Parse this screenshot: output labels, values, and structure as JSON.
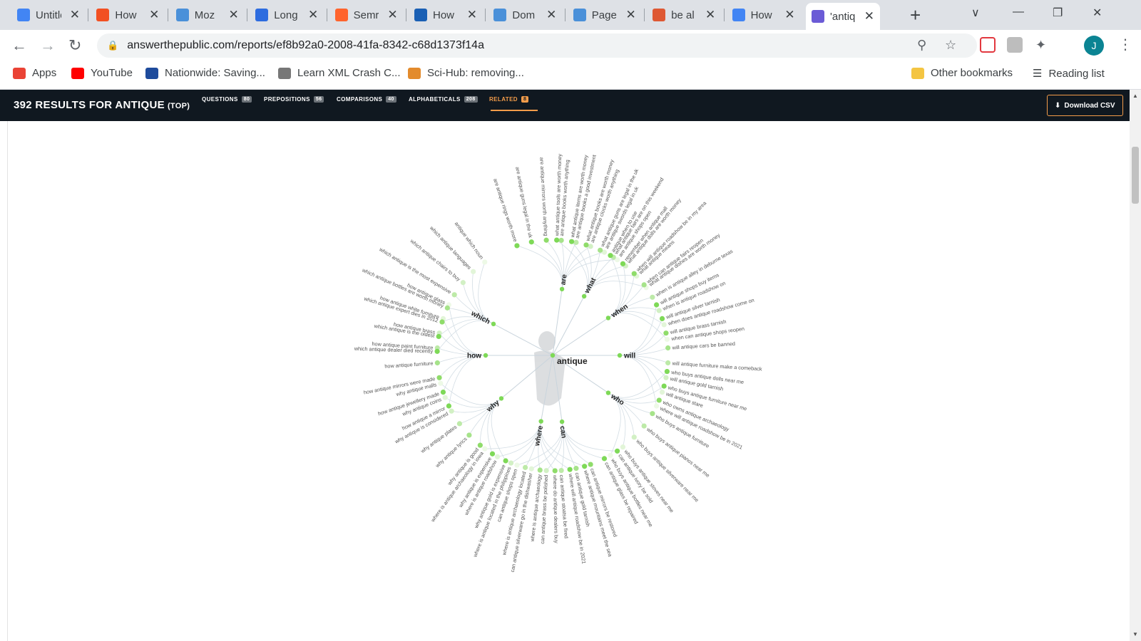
{
  "browser": {
    "tabs": [
      {
        "title": "Untitled",
        "icon": "google-docs-icon",
        "color": "#4285f4"
      },
      {
        "title": "How",
        "icon": "microsoft-icon",
        "color": "#f25022"
      },
      {
        "title": "Moz",
        "icon": "moz-icon",
        "color": "#4a90d9"
      },
      {
        "title": "Long",
        "icon": "longtail-icon",
        "color": "#2d6cdf"
      },
      {
        "title": "Semrush",
        "icon": "semrush-icon",
        "color": "#ff642d"
      },
      {
        "title": "How",
        "icon": "hubpages-icon",
        "color": "#1a5fb4"
      },
      {
        "title": "Dom",
        "icon": "moz-icon",
        "color": "#4a90d9"
      },
      {
        "title": "Page",
        "icon": "moz-icon",
        "color": "#4a90d9"
      },
      {
        "title": "be al",
        "icon": "duckduckgo-icon",
        "color": "#de5833"
      },
      {
        "title": "How",
        "icon": "google-docs-icon",
        "color": "#4285f4"
      },
      {
        "title": "'antique",
        "icon": "answerthepublic-icon",
        "color": "#6b5bd6"
      }
    ],
    "url": "answerthepublic.com/reports/ef8b92a0-2008-41fa-8342-c68d1373f14a",
    "profile_initial": "J",
    "bookmarks": [
      {
        "label": "Apps",
        "icon": "apps-grid-icon",
        "color": "#ea4335"
      },
      {
        "label": "YouTube",
        "icon": "youtube-icon",
        "color": "#ff0000"
      },
      {
        "label": "Nationwide: Saving...",
        "icon": "nationwide-icon",
        "color": "#1e4b9c"
      },
      {
        "label": "Learn XML Crash C...",
        "icon": "xml-icon",
        "color": "#777777"
      },
      {
        "label": "Sci-Hub: removing...",
        "icon": "scihub-icon",
        "color": "#e38b2c"
      }
    ],
    "other_bookmarks": "Other bookmarks",
    "reading_list": "Reading list"
  },
  "site": {
    "results_title": "392 RESULTS FOR ANTIQUE",
    "results_sub": "(TOP)",
    "tabs": [
      {
        "label": "QUESTIONS",
        "count": "80"
      },
      {
        "label": "PREPOSITIONS",
        "count": "56"
      },
      {
        "label": "COMPARISONS",
        "count": "40"
      },
      {
        "label": "ALPHABETICALS",
        "count": "208"
      },
      {
        "label": "RELATED",
        "count": "8"
      }
    ],
    "download_label": "Download CSV",
    "accent": "#f39c4a"
  },
  "wheel": {
    "center_label": "antique",
    "branches": [
      {
        "label": "are",
        "leaves": [
          "are antique rings worth more",
          "are antique guns legal in the uk",
          "are antique mirrors worth anything",
          "are antique books worth anything",
          "are antique books a good investment",
          "are antique clocks worth anything",
          "are antique swords legal in uk",
          "are antique shops open"
        ]
      },
      {
        "label": "what",
        "leaves": [
          "what antique tools are worth money",
          "what antique items are worth money",
          "what antique books are worth money",
          "what antique guns are legal in the uk",
          "what antique fairs are on this weekend",
          "what antique dolls are worth money",
          "what antique means",
          "what antique dishes are worth money"
        ]
      },
      {
        "label": "when",
        "leaves": [
          "antique when to use",
          "remember when antique mall",
          "when will antique roadshow be in my area",
          "when can antique fairs reopen",
          "when is antique alley in deburne texas",
          "when is antique roadshow on",
          "when does antique roadshow come on",
          "when can antique shops reopen"
        ]
      },
      {
        "label": "will",
        "leaves": [
          "will antique shops buy items",
          "will antique silver tarnish",
          "will antique brass tarnish",
          "will antique cars be banned",
          "will antique furniture make a comeback",
          "will antique gold tarnish",
          "will antique stare",
          "where will antique roadshow be in 2021"
        ]
      },
      {
        "label": "who",
        "leaves": [
          "who buys antique dolls near me",
          "who buys antique furniture near me",
          "who owns antique archaeology",
          "who buys antique furniture",
          "who buys antique pianos near me",
          "who buys antique silverware near me",
          "who buys antique stoves near me",
          "who buys antique bottles near me"
        ]
      },
      {
        "label": "can",
        "leaves": [
          "can antique ivory be sold",
          "can antique glass be repaired",
          "can antique mirrors be restored",
          "can antique gold tarnish",
          "can antique stoatsa be fired",
          "can antique brass be polished",
          "can antique silverware go in the dishwasher",
          "can antique shops open"
        ]
      },
      {
        "label": "where",
        "leaves": [
          "where antique mountains meet the sea",
          "where will antique roadshow be in 2021",
          "where do antique dealers buy",
          "where is antique archaeology",
          "where is antique archaeology located",
          "where is antique located in the philippines",
          "where is antique roadshow",
          "where is antique archaeology in iowa"
        ]
      },
      {
        "label": "why",
        "leaves": [
          "why antique gold is expensive",
          "why antique is expensive",
          "why antique is good",
          "why antique lyrics",
          "why antique plates",
          "why antique is considered",
          "why antique coins",
          "why antique malls"
        ]
      },
      {
        "label": "how",
        "leaves": [
          "how antique a mirror",
          "how antique jewellery made",
          "how antique mirrors were made",
          "how antique furniture",
          "how antique paint furniture",
          "how antique brass",
          "how antique white furniture",
          "how antique glass"
        ]
      },
      {
        "label": "which",
        "leaves": [
          "which antique dealer died recently",
          "which antique is the oldest",
          "which antique expert dies in 2012",
          "which antique bottles are worth money",
          "which antique is the most expensive",
          "which antique chairs to buy",
          "which antique languages",
          "antique which noun"
        ]
      }
    ]
  }
}
